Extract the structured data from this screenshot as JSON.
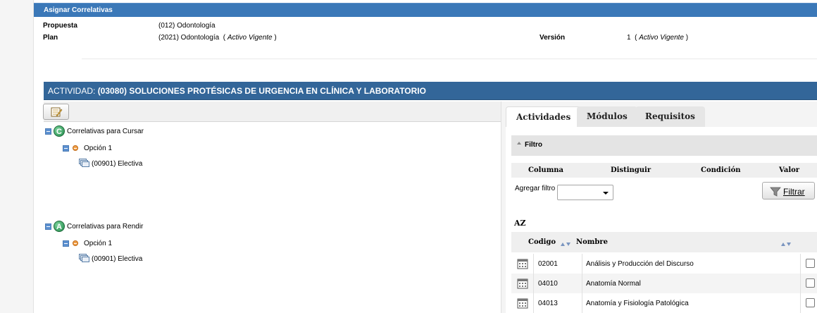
{
  "panel": {
    "title": "Asignar Correlativas"
  },
  "info": {
    "propuesta_label": "Propuesta",
    "propuesta_value": "(012) Odontología",
    "plan_label": "Plan",
    "plan_value": "(2021) Odontología",
    "plan_status": "Activo Vigente",
    "version_label": "Versión",
    "version_value": "1",
    "version_status": "Activo Vigente"
  },
  "actividad": {
    "label": "ACTIVIDAD:",
    "value": "(03080) SOLUCIONES PROTÉSICAS DE URGENCIA EN CLÍNICA Y LABORATORIO"
  },
  "tree": {
    "cursar": {
      "icon_letter": "C",
      "label": "Correlativas para Cursar",
      "option": "Opción 1",
      "item": "(00901) Electiva"
    },
    "rendir": {
      "icon_letter": "A",
      "label": "Correlativas para Rendir",
      "option": "Opción 1",
      "item": "(00901) Electiva"
    }
  },
  "tabs": [
    {
      "label": "Actividades",
      "active": true
    },
    {
      "label": "Módulos",
      "active": false
    },
    {
      "label": "Requisitos",
      "active": false
    }
  ],
  "filtro": {
    "title": "Filtro",
    "columns": [
      "Columna",
      "Distinguir",
      "Condición",
      "Valor"
    ],
    "agregar_label": "Agregar filtro",
    "agregar_value": "",
    "filtrar_label": "Filtrar"
  },
  "list": {
    "az_label": "AZ",
    "col_codigo": "Codigo",
    "col_nombre": "Nombre",
    "rows": [
      {
        "codigo": "02001",
        "nombre": "Análisis y Producción del Discurso",
        "checked": false
      },
      {
        "codigo": "04010",
        "nombre": "Anatomía Normal",
        "checked": false
      },
      {
        "codigo": "04013",
        "nombre": "Anatomía y Fisiología Patológica",
        "checked": false
      }
    ]
  },
  "colors": {
    "header_blue": "#3b78b8",
    "activity_bar": "#336699",
    "tree_toggle": "#5c90d0",
    "option_dot": "#f0a048"
  }
}
